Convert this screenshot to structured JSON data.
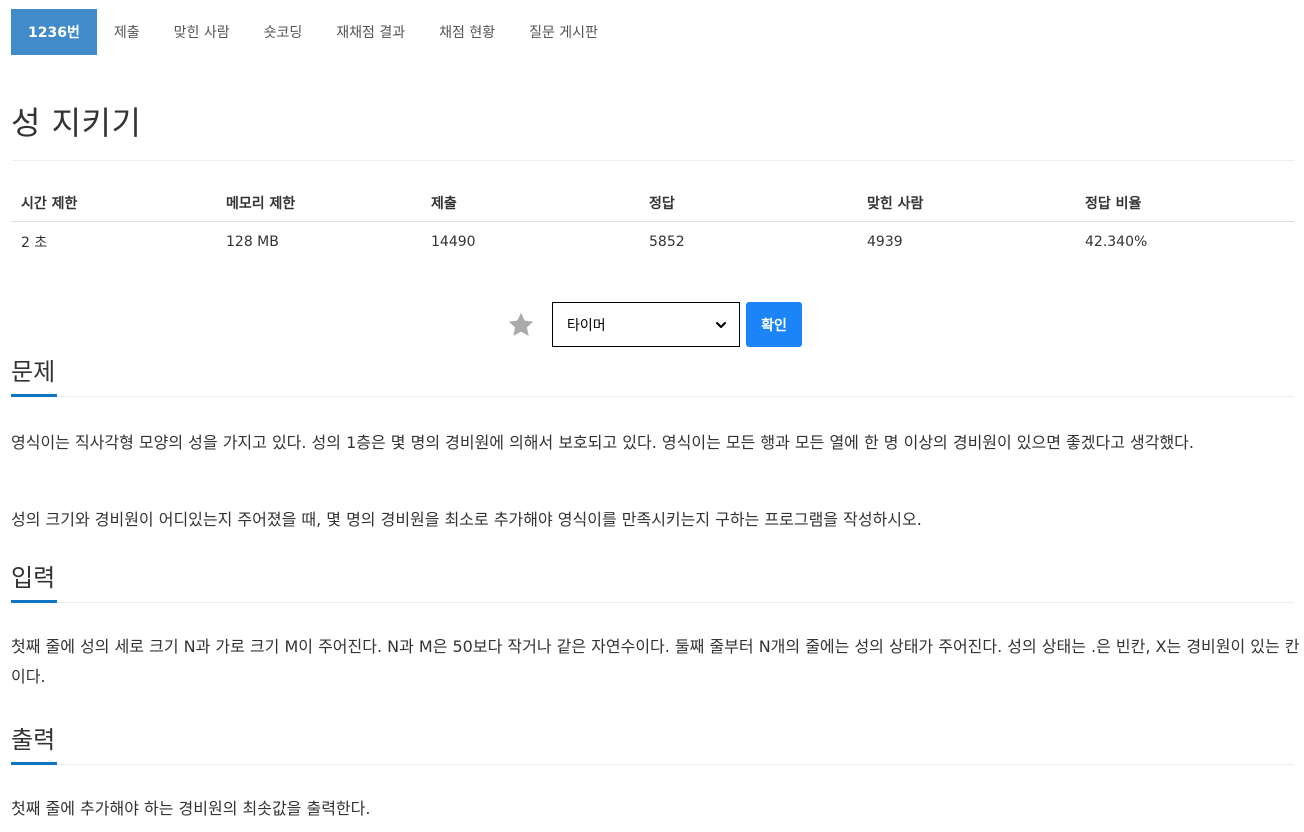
{
  "tabs": [
    {
      "label": "1236번",
      "active": true
    },
    {
      "label": "제출"
    },
    {
      "label": "맞힌 사람"
    },
    {
      "label": "숏코딩"
    },
    {
      "label": "재채점 결과"
    },
    {
      "label": "채점 현황"
    },
    {
      "label": "질문 게시판"
    }
  ],
  "problem": {
    "title": "성 지키기"
  },
  "info_table": {
    "headers": [
      "시간 제한",
      "메모리 제한",
      "제출",
      "정답",
      "맞힌 사람",
      "정답 비율"
    ],
    "values": [
      "2 초",
      "128 MB",
      "14490",
      "5852",
      "4939",
      "42.340%"
    ]
  },
  "toolbar": {
    "select_value": "타이머",
    "confirm_label": "확인",
    "star_color": "#aaaaaa",
    "confirm_color": "#1a84f8"
  },
  "sections": {
    "description": {
      "heading": "문제",
      "paragraphs": [
        "영식이는 직사각형 모양의 성을 가지고 있다. 성의 1층은 몇 명의 경비원에 의해서 보호되고 있다. 영식이는 모든 행과 모든 열에 한 명 이상의 경비원이 있으면 좋겠다고 생각했다.",
        "성의 크기와 경비원이 어디있는지 주어졌을 때, 몇 명의 경비원을 최소로 추가해야 영식이를 만족시키는지 구하는 프로그램을 작성하시오."
      ]
    },
    "input": {
      "heading": "입력",
      "paragraphs": [
        "첫째 줄에 성의 세로 크기 N과 가로 크기 M이 주어진다. N과 M은 50보다 작거나 같은 자연수이다. 둘째 줄부터 N개의 줄에는 성의 상태가 주어진다. 성의 상태는 .은 빈칸, X는 경비원이 있는 칸이다."
      ]
    },
    "output": {
      "heading": "출력",
      "paragraphs": [
        "첫째 줄에 추가해야 하는 경비원의 최솟값을 출력한다."
      ]
    }
  }
}
